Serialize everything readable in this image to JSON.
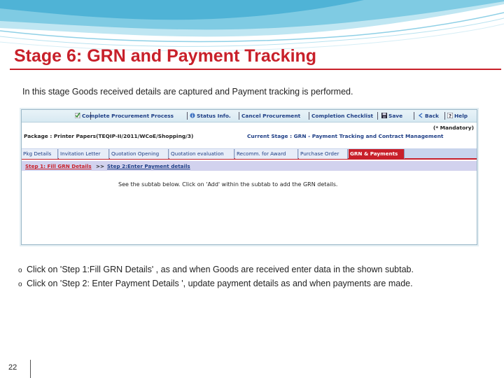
{
  "slide": {
    "title": "Stage 6: GRN and Payment Tracking",
    "intro": "In this stage Goods received details are captured and Payment tracking is performed.",
    "bullets": [
      "Click on 'Step 1:Fill GRN Details' , as and when Goods are received enter data in the shown subtab.",
      "Click on 'Step 2: Enter Payment Details ', update payment details as and when payments are made."
    ],
    "bullet_mark": "o",
    "page_number": "22"
  },
  "screenshot": {
    "toolbar": [
      {
        "label": "Complete Procurement Process",
        "icon": "complete-check-icon"
      },
      {
        "label": "Status Info.",
        "icon": "status-info-icon"
      },
      {
        "label": "Cancel Procurement",
        "icon": ""
      },
      {
        "label": "Completion Checklist",
        "icon": ""
      },
      {
        "label": "Save",
        "icon": "save-icon"
      },
      {
        "label": "Back",
        "icon": "back-icon"
      },
      {
        "label": "Help",
        "icon": "help-icon"
      }
    ],
    "mandatory": "(* Mandatory)",
    "package": "Package : Printer Papers(TEQIP-II/2011/WCoE/Shopping/3)",
    "current_stage": "Current Stage : GRN - Payment Tracking and Contract Management",
    "tabs": [
      "Pkg Details",
      "Invitation Letter",
      "Quotation Opening",
      "Quotation evaluation",
      "Recomm. for Award",
      "Purchase Order",
      "GRN & Payments"
    ],
    "active_tab": "GRN & Payments",
    "subtabs": {
      "step1": "Step 1: Fill GRN Details",
      "arrow": ">>",
      "step2": "Step 2:Enter Payment details"
    },
    "hint": "See the subtab below. Click on 'Add' within the subtab to add the GRN details."
  },
  "colors": {
    "title": "#c8202a",
    "link_blue": "#1f3f86",
    "active_tab": "#c8202a"
  }
}
